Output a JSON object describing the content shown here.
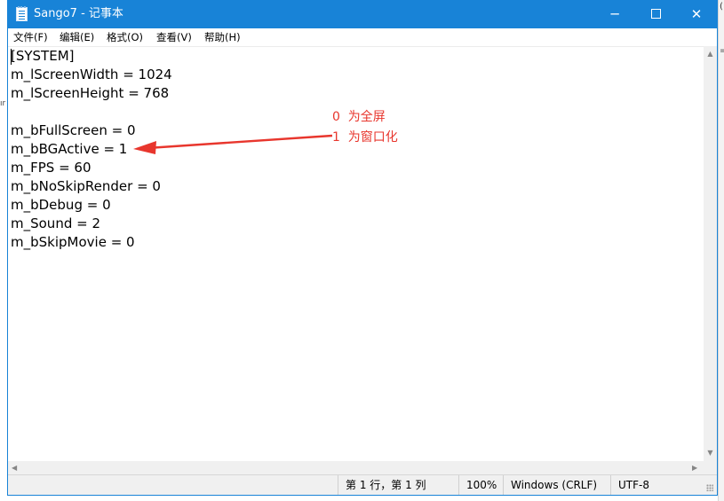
{
  "window": {
    "title": "Sango7 - 记事本",
    "controls": {
      "minimize": "─",
      "close": "✕"
    }
  },
  "menu": [
    {
      "label": "文件(F)"
    },
    {
      "label": "编辑(E)"
    },
    {
      "label": "格式(O)"
    },
    {
      "label": "查看(V)"
    },
    {
      "label": "帮助(H)"
    }
  ],
  "document": {
    "lines": [
      "[SYSTEM]",
      "m_lScreenWidth = 1024",
      "m_lScreenHeight = 768",
      "",
      "m_bFullScreen = 0",
      "m_bBGActive = 1",
      "m_FPS = 60",
      "m_bNoSkipRender = 0",
      "m_bDebug = 0",
      "m_Sound = 2",
      "m_bSkipMovie = 0"
    ]
  },
  "annotation": {
    "line1": "0  为全屏",
    "line2": "1  为窗口化",
    "color": "#e8362d"
  },
  "statusbar": {
    "position": "第 1 行，第 1 列",
    "zoom": "100%",
    "line_ending": "Windows (CRLF)",
    "encoding": "UTF-8"
  },
  "background_window": {
    "edge_chars": [
      "(",
      "="
    ],
    "left_edge_char": "ır"
  },
  "colors": {
    "titlebar": "#1883d7",
    "annotation": "#e8362d"
  }
}
